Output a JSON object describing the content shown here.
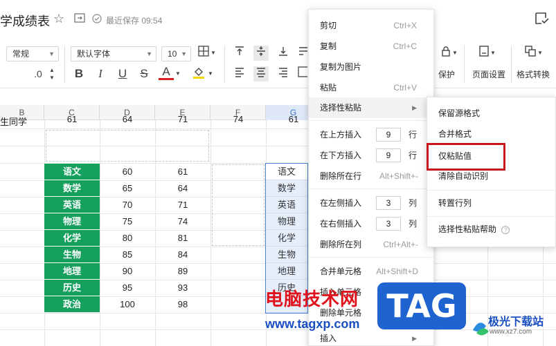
{
  "titlebar": {
    "doc_title": "学成绩表",
    "save_status": "最近保存 09:54"
  },
  "toolbar": {
    "number_format": "常规",
    "decimal": ".0",
    "font_name": "默认字体",
    "font_size": "10",
    "bold": "B",
    "italic": "I",
    "underline": "U",
    "strike": "S",
    "font_color": "A",
    "protect_label": "保护",
    "page_setup_label": "页面设置",
    "format_convert_label": "格式转换"
  },
  "columns": [
    "B",
    "C",
    "D",
    "E",
    "F",
    "G"
  ],
  "top_row": [
    "生同学",
    "61",
    "64",
    "71",
    "74",
    "61"
  ],
  "rows": [
    {
      "subject": "语文",
      "d": "60",
      "e": "61",
      "g": "语文"
    },
    {
      "subject": "数学",
      "d": "65",
      "e": "64",
      "g": "数学"
    },
    {
      "subject": "英语",
      "d": "70",
      "e": "71",
      "g": "英语"
    },
    {
      "subject": "物理",
      "d": "75",
      "e": "74",
      "g": "物理"
    },
    {
      "subject": "化学",
      "d": "80",
      "e": "81",
      "g": "化学"
    },
    {
      "subject": "生物",
      "d": "85",
      "e": "84",
      "g": "生物"
    },
    {
      "subject": "地理",
      "d": "90",
      "e": "89",
      "g": "地理"
    },
    {
      "subject": "历史",
      "d": "95",
      "e": "93",
      "g": "历史"
    },
    {
      "subject": "政治",
      "d": "100",
      "e": "98",
      "g": ""
    }
  ],
  "menu": {
    "cut": "剪切",
    "cut_sc": "Ctrl+X",
    "copy": "复制",
    "copy_sc": "Ctrl+C",
    "copy_as_image": "复制为图片",
    "paste": "粘贴",
    "paste_sc": "Ctrl+V",
    "paste_special": "选择性粘贴",
    "insert_above": "在上方插入",
    "insert_above_n": "9",
    "row_unit": "行",
    "insert_below": "在下方插入",
    "insert_below_n": "9",
    "delete_row": "删除所在行",
    "delete_row_sc": "Alt+Shift+-",
    "insert_left": "在左侧插入",
    "insert_left_n": "3",
    "col_unit": "列",
    "insert_right": "在右侧插入",
    "insert_right_n": "3",
    "delete_col": "删除所在列",
    "delete_col_sc": "Ctrl+Alt+-",
    "merge_cells": "合并单元格",
    "merge_cells_sc": "Alt+Shift+D",
    "insert_cells": "插入单元格",
    "delete_cells": "删除单元格",
    "insert": "插入"
  },
  "submenu": {
    "keep_source": "保留源格式",
    "merge_format": "合并格式",
    "values_only": "仅粘贴值",
    "clear_auto": "清除自动识别",
    "transpose": "转置行列",
    "help": "选择性粘贴帮助"
  },
  "watermark": {
    "site_name": "电脑技术网",
    "site_url": "www.tagxp.com",
    "tag": "TAG",
    "logo_text": "极光下载站",
    "logo_url": "www.xz7.com"
  },
  "colors": {
    "subject_green": "#16a05d",
    "highlight_red": "#c8161d",
    "selection_blue": "#e6eefc"
  }
}
